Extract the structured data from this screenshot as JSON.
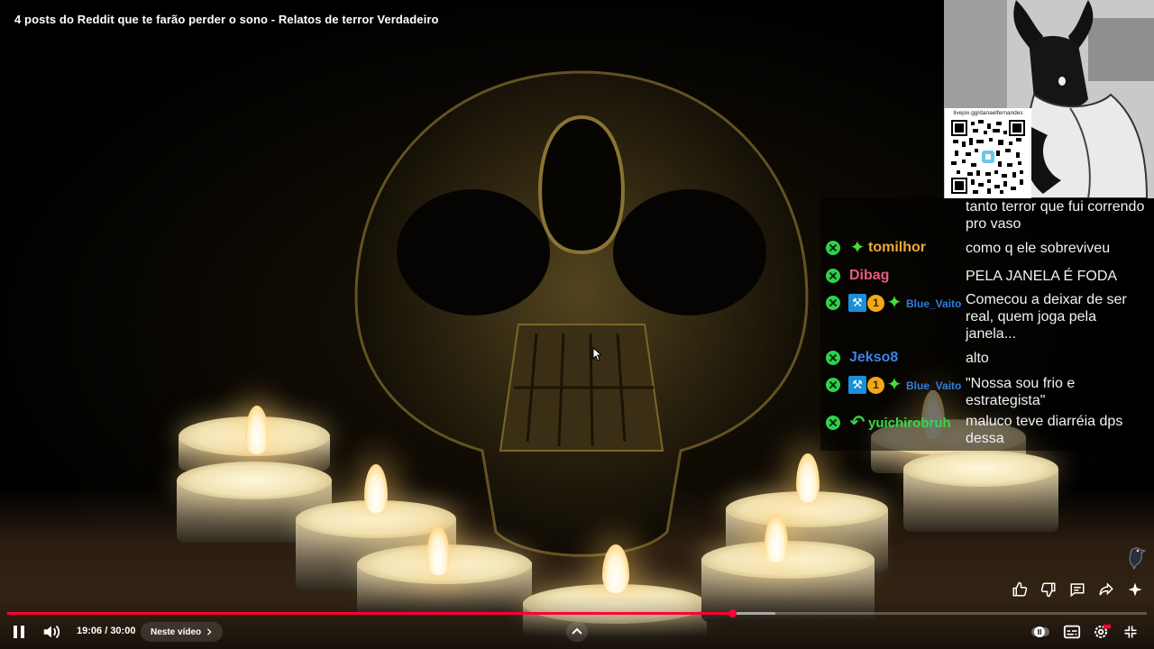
{
  "video": {
    "title": "4 posts do Reddit que te farão perder o sono - Relatos de terror Verdadeiro"
  },
  "webcam": {
    "qr_url": "livepix.gg/danaelfernandes"
  },
  "chat": {
    "partial_message_text": "tanto terror que fui correndo pro vaso",
    "messages": [
      {
        "badges": [
          "star"
        ],
        "user": "tomilhor",
        "user_color": "#f0a83a",
        "text": "como q ele sobreviveu"
      },
      {
        "badges": [],
        "user": "Dibag",
        "user_color": "#e45b7a",
        "text": "PELA JANELA É FODA"
      },
      {
        "badges": [
          "hammer",
          "coin",
          "star"
        ],
        "coin_value": "1",
        "user": "Blue_Vaito",
        "user_color": "#2f7fe0",
        "text": "Comecou a deixar de ser real, quem joga pela janela..."
      },
      {
        "badges": [],
        "user": "Jekso8",
        "user_color": "#3d82ea",
        "text": "alto"
      },
      {
        "badges": [
          "hammer",
          "coin",
          "star"
        ],
        "coin_value": "1",
        "user": "Blue_Vaito",
        "user_color": "#2f7fe0",
        "text": "\"Nossa sou frio e estrategista\""
      },
      {
        "badges": [
          "arrow"
        ],
        "user": "yuichirobruh",
        "user_color": "#34d84b",
        "text": "maluco teve diarréia dps dessa"
      }
    ]
  },
  "player": {
    "current_time": "19:06",
    "separator": " / ",
    "duration": "30:00",
    "played_fraction": 0.636,
    "buffered_fraction": 0.674,
    "next_label": "Neste vídeo",
    "accent": "#ff0033"
  },
  "icons": {
    "play_pause": "pause-icon",
    "volume": "volume-icon",
    "chevron": "chevron-up-icon",
    "like": "thumbs-up-icon",
    "dislike": "thumbs-down-icon",
    "comments": "comment-icon",
    "share": "share-icon",
    "ask": "sparkle-icon",
    "autoplay": "autoplay-toggle-icon",
    "captions": "captions-icon",
    "settings": "settings-icon",
    "exit_fullscreen": "exit-fullscreen-icon"
  }
}
